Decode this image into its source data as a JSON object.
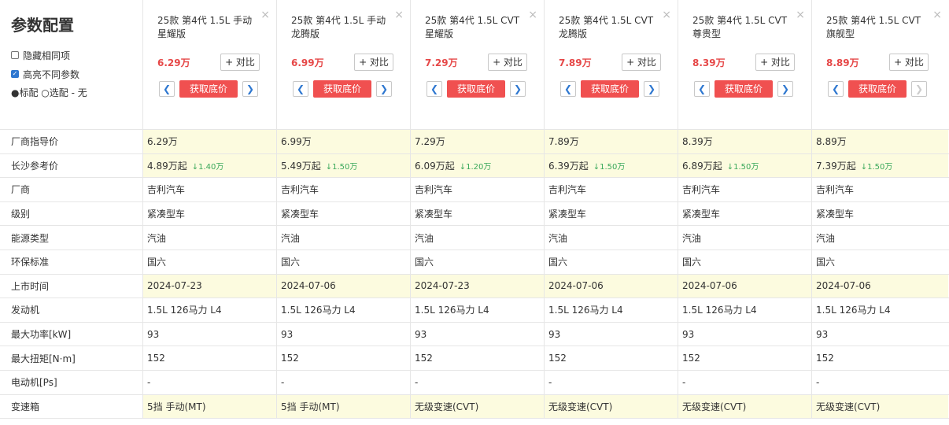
{
  "sidebar": {
    "title": "参数配置",
    "hide_same_label": "隐藏相同项",
    "highlight_diff_label": "高亮不同参数",
    "legend": "●标配 ○选配 - 无"
  },
  "cars": [
    {
      "name": "25款 第4代 1.5L 手动星耀版",
      "price": "6.29万",
      "compare_label": "+ 对比",
      "get_price_label": "获取底价",
      "close": "×"
    },
    {
      "name": "25款 第4代 1.5L 手动龙腾版",
      "price": "6.99万",
      "compare_label": "+ 对比",
      "get_price_label": "获取底价",
      "close": "×"
    },
    {
      "name": "25款 第4代 1.5L CVT星耀版",
      "price": "7.29万",
      "compare_label": "+ 对比",
      "get_price_label": "获取底价",
      "close": "×"
    },
    {
      "name": "25款 第4代 1.5L CVT龙腾版",
      "price": "7.89万",
      "compare_label": "+ 对比",
      "get_price_label": "获取底价",
      "close": "×"
    },
    {
      "name": "25款 第4代 1.5L CVT尊贵型",
      "price": "8.39万",
      "compare_label": "+ 对比",
      "get_price_label": "获取底价",
      "close": "×"
    },
    {
      "name": "25款 第4代 1.5L CVT旗舰型",
      "price": "8.89万",
      "compare_label": "+ 对比",
      "get_price_label": "获取底价",
      "close": "×"
    }
  ],
  "rows": [
    {
      "label": "厂商指导价",
      "highlight": true,
      "values": [
        "6.29万",
        "6.99万",
        "7.29万",
        "7.89万",
        "8.39万",
        "8.89万"
      ]
    },
    {
      "label": "长沙参考价",
      "highlight": true,
      "values": [
        "4.89万起",
        "5.49万起",
        "6.09万起",
        "6.39万起",
        "6.89万起",
        "7.39万起"
      ],
      "drops": [
        "↓1.40万",
        "↓1.50万",
        "↓1.20万",
        "↓1.50万",
        "↓1.50万",
        "↓1.50万"
      ]
    },
    {
      "label": "厂商",
      "highlight": false,
      "values": [
        "吉利汽车",
        "吉利汽车",
        "吉利汽车",
        "吉利汽车",
        "吉利汽车",
        "吉利汽车"
      ]
    },
    {
      "label": "级别",
      "highlight": false,
      "values": [
        "紧凑型车",
        "紧凑型车",
        "紧凑型车",
        "紧凑型车",
        "紧凑型车",
        "紧凑型车"
      ]
    },
    {
      "label": "能源类型",
      "highlight": false,
      "values": [
        "汽油",
        "汽油",
        "汽油",
        "汽油",
        "汽油",
        "汽油"
      ]
    },
    {
      "label": "环保标准",
      "highlight": false,
      "values": [
        "国六",
        "国六",
        "国六",
        "国六",
        "国六",
        "国六"
      ]
    },
    {
      "label": "上市时间",
      "highlight": true,
      "values": [
        "2024-07-23",
        "2024-07-06",
        "2024-07-23",
        "2024-07-06",
        "2024-07-06",
        "2024-07-06"
      ]
    },
    {
      "label": "发动机",
      "highlight": false,
      "values": [
        "1.5L 126马力 L4",
        "1.5L 126马力 L4",
        "1.5L 126马力 L4",
        "1.5L 126马力 L4",
        "1.5L 126马力 L4",
        "1.5L 126马力 L4"
      ]
    },
    {
      "label": "最大功率[kW]",
      "highlight": false,
      "values": [
        "93",
        "93",
        "93",
        "93",
        "93",
        "93"
      ]
    },
    {
      "label": "最大扭矩[N·m]",
      "highlight": false,
      "values": [
        "152",
        "152",
        "152",
        "152",
        "152",
        "152"
      ]
    },
    {
      "label": "电动机[Ps]",
      "highlight": false,
      "values": [
        "-",
        "-",
        "-",
        "-",
        "-",
        "-"
      ]
    },
    {
      "label": "变速箱",
      "highlight": true,
      "values": [
        "5挡 手动(MT)",
        "5挡 手动(MT)",
        "无级变速(CVT)",
        "无级变速(CVT)",
        "无级变速(CVT)",
        "无级变速(CVT)"
      ]
    }
  ],
  "icons": {
    "prev": "arrow-left-icon",
    "next": "arrow-right-icon",
    "close": "close-icon",
    "checkbox": "checkbox-icon"
  },
  "colors": {
    "price_red": "#e64848",
    "button_red": "#f05050",
    "highlight_bg": "#fcfbdf",
    "drop_green": "#3aa85a",
    "link_blue": "#2e77d0"
  }
}
